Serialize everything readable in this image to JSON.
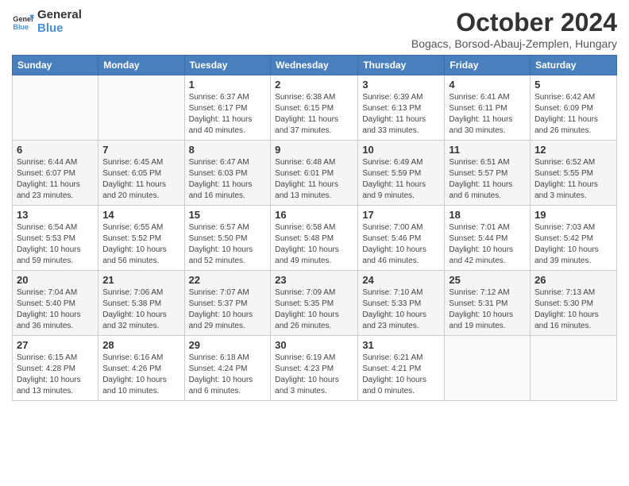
{
  "header": {
    "logo_line1": "General",
    "logo_line2": "Blue",
    "month_title": "October 2024",
    "subtitle": "Bogacs, Borsod-Abauj-Zemplen, Hungary"
  },
  "days_of_week": [
    "Sunday",
    "Monday",
    "Tuesday",
    "Wednesday",
    "Thursday",
    "Friday",
    "Saturday"
  ],
  "weeks": [
    [
      {
        "num": "",
        "info": ""
      },
      {
        "num": "",
        "info": ""
      },
      {
        "num": "1",
        "info": "Sunrise: 6:37 AM\nSunset: 6:17 PM\nDaylight: 11 hours and 40 minutes."
      },
      {
        "num": "2",
        "info": "Sunrise: 6:38 AM\nSunset: 6:15 PM\nDaylight: 11 hours and 37 minutes."
      },
      {
        "num": "3",
        "info": "Sunrise: 6:39 AM\nSunset: 6:13 PM\nDaylight: 11 hours and 33 minutes."
      },
      {
        "num": "4",
        "info": "Sunrise: 6:41 AM\nSunset: 6:11 PM\nDaylight: 11 hours and 30 minutes."
      },
      {
        "num": "5",
        "info": "Sunrise: 6:42 AM\nSunset: 6:09 PM\nDaylight: 11 hours and 26 minutes."
      }
    ],
    [
      {
        "num": "6",
        "info": "Sunrise: 6:44 AM\nSunset: 6:07 PM\nDaylight: 11 hours and 23 minutes."
      },
      {
        "num": "7",
        "info": "Sunrise: 6:45 AM\nSunset: 6:05 PM\nDaylight: 11 hours and 20 minutes."
      },
      {
        "num": "8",
        "info": "Sunrise: 6:47 AM\nSunset: 6:03 PM\nDaylight: 11 hours and 16 minutes."
      },
      {
        "num": "9",
        "info": "Sunrise: 6:48 AM\nSunset: 6:01 PM\nDaylight: 11 hours and 13 minutes."
      },
      {
        "num": "10",
        "info": "Sunrise: 6:49 AM\nSunset: 5:59 PM\nDaylight: 11 hours and 9 minutes."
      },
      {
        "num": "11",
        "info": "Sunrise: 6:51 AM\nSunset: 5:57 PM\nDaylight: 11 hours and 6 minutes."
      },
      {
        "num": "12",
        "info": "Sunrise: 6:52 AM\nSunset: 5:55 PM\nDaylight: 11 hours and 3 minutes."
      }
    ],
    [
      {
        "num": "13",
        "info": "Sunrise: 6:54 AM\nSunset: 5:53 PM\nDaylight: 10 hours and 59 minutes."
      },
      {
        "num": "14",
        "info": "Sunrise: 6:55 AM\nSunset: 5:52 PM\nDaylight: 10 hours and 56 minutes."
      },
      {
        "num": "15",
        "info": "Sunrise: 6:57 AM\nSunset: 5:50 PM\nDaylight: 10 hours and 52 minutes."
      },
      {
        "num": "16",
        "info": "Sunrise: 6:58 AM\nSunset: 5:48 PM\nDaylight: 10 hours and 49 minutes."
      },
      {
        "num": "17",
        "info": "Sunrise: 7:00 AM\nSunset: 5:46 PM\nDaylight: 10 hours and 46 minutes."
      },
      {
        "num": "18",
        "info": "Sunrise: 7:01 AM\nSunset: 5:44 PM\nDaylight: 10 hours and 42 minutes."
      },
      {
        "num": "19",
        "info": "Sunrise: 7:03 AM\nSunset: 5:42 PM\nDaylight: 10 hours and 39 minutes."
      }
    ],
    [
      {
        "num": "20",
        "info": "Sunrise: 7:04 AM\nSunset: 5:40 PM\nDaylight: 10 hours and 36 minutes."
      },
      {
        "num": "21",
        "info": "Sunrise: 7:06 AM\nSunset: 5:38 PM\nDaylight: 10 hours and 32 minutes."
      },
      {
        "num": "22",
        "info": "Sunrise: 7:07 AM\nSunset: 5:37 PM\nDaylight: 10 hours and 29 minutes."
      },
      {
        "num": "23",
        "info": "Sunrise: 7:09 AM\nSunset: 5:35 PM\nDaylight: 10 hours and 26 minutes."
      },
      {
        "num": "24",
        "info": "Sunrise: 7:10 AM\nSunset: 5:33 PM\nDaylight: 10 hours and 23 minutes."
      },
      {
        "num": "25",
        "info": "Sunrise: 7:12 AM\nSunset: 5:31 PM\nDaylight: 10 hours and 19 minutes."
      },
      {
        "num": "26",
        "info": "Sunrise: 7:13 AM\nSunset: 5:30 PM\nDaylight: 10 hours and 16 minutes."
      }
    ],
    [
      {
        "num": "27",
        "info": "Sunrise: 6:15 AM\nSunset: 4:28 PM\nDaylight: 10 hours and 13 minutes."
      },
      {
        "num": "28",
        "info": "Sunrise: 6:16 AM\nSunset: 4:26 PM\nDaylight: 10 hours and 10 minutes."
      },
      {
        "num": "29",
        "info": "Sunrise: 6:18 AM\nSunset: 4:24 PM\nDaylight: 10 hours and 6 minutes."
      },
      {
        "num": "30",
        "info": "Sunrise: 6:19 AM\nSunset: 4:23 PM\nDaylight: 10 hours and 3 minutes."
      },
      {
        "num": "31",
        "info": "Sunrise: 6:21 AM\nSunset: 4:21 PM\nDaylight: 10 hours and 0 minutes."
      },
      {
        "num": "",
        "info": ""
      },
      {
        "num": "",
        "info": ""
      }
    ]
  ]
}
